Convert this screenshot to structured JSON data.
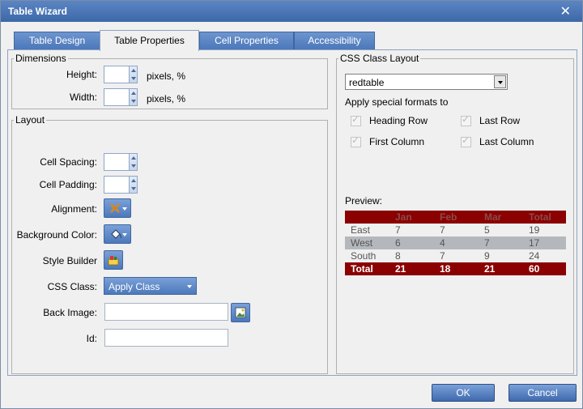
{
  "window": {
    "title": "Table Wizard",
    "close_glyph": "✕"
  },
  "tabs": [
    {
      "label": "Table Design"
    },
    {
      "label": "Table Properties"
    },
    {
      "label": "Cell Properties"
    },
    {
      "label": "Accessibility"
    }
  ],
  "active_tab": "Table Properties",
  "dimensions": {
    "legend": "Dimensions",
    "height_label": "Height:",
    "height_value": "",
    "height_suffix": "pixels, %",
    "width_label": "Width:",
    "width_value": "",
    "width_suffix": "pixels, %"
  },
  "layout": {
    "legend": "Layout",
    "cell_spacing_label": "Cell Spacing:",
    "cell_padding_label": "Cell Padding:",
    "alignment_label": "Alignment:",
    "alignment_icon": "align-none-icon",
    "background_color_label": "Background Color:",
    "background_color_icon": "paint-bucket-icon",
    "style_builder_label": "Style Builder",
    "style_builder_icon": "style-builder-icon",
    "css_class_label": "CSS Class:",
    "css_class_value": "Apply Class",
    "back_image_label": "Back Image:",
    "back_image_value": "",
    "back_image_icon": "image-browse-icon",
    "id_label": "Id:",
    "id_value": ""
  },
  "css_class_layout": {
    "legend": "CSS Class Layout",
    "selected": "redtable",
    "apply_label": "Apply special formats to",
    "options": [
      {
        "label": "Heading Row",
        "checked": true
      },
      {
        "label": "Last Row",
        "checked": true
      },
      {
        "label": "First Column",
        "checked": true
      },
      {
        "label": "Last Column",
        "checked": true
      }
    ],
    "preview_label": "Preview:",
    "preview_header": [
      "",
      "Jan",
      "Feb",
      "Mar",
      "Total"
    ],
    "preview_rows": [
      [
        "East",
        "7",
        "7",
        "5",
        "19"
      ],
      [
        "West",
        "6",
        "4",
        "7",
        "17"
      ],
      [
        "South",
        "8",
        "7",
        "9",
        "24"
      ]
    ],
    "preview_total": [
      "Total",
      "21",
      "18",
      "21",
      "60"
    ]
  },
  "buttons": {
    "ok": "OK",
    "cancel": "Cancel"
  },
  "colors": {
    "titlebar": "#4a76b8",
    "preview_header_bg": "#8b0000",
    "preview_header_text": "#8b4a4a",
    "preview_total_bg": "#8b0000",
    "preview_alt_row_bg": "#b4b8bc",
    "preview_row_bg": "#f0f0f0"
  }
}
